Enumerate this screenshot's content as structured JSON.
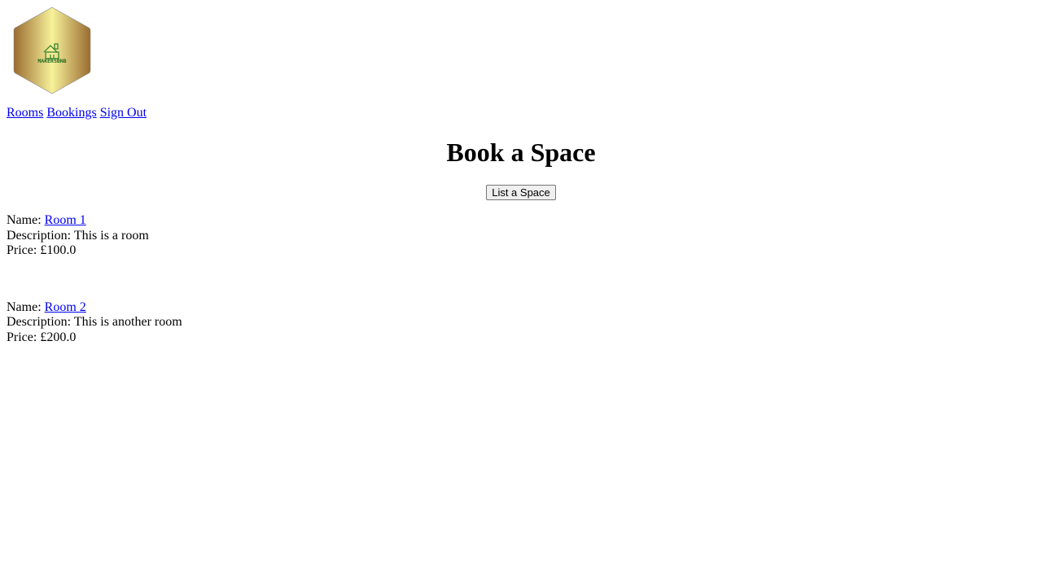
{
  "logo": {
    "text": "MAKERSBNB",
    "colors": {
      "gold_light": "#f7f19a",
      "gold_dark": "#9a6c30",
      "green": "#1f6b1f"
    }
  },
  "nav": {
    "items": [
      {
        "label": "Rooms"
      },
      {
        "label": "Bookings"
      },
      {
        "label": "Sign Out"
      }
    ]
  },
  "main": {
    "title": "Book a Space",
    "list_button_label": "List a Space"
  },
  "rooms": [
    {
      "name_label": "Name: ",
      "name": "Room 1",
      "description_label": "Description: ",
      "description": "This is a room",
      "price_label": "Price: ",
      "price": "£100.0"
    },
    {
      "name_label": "Name: ",
      "name": "Room 2",
      "description_label": "Description: ",
      "description": "This is another room",
      "price_label": "Price: ",
      "price": "£200.0"
    }
  ]
}
